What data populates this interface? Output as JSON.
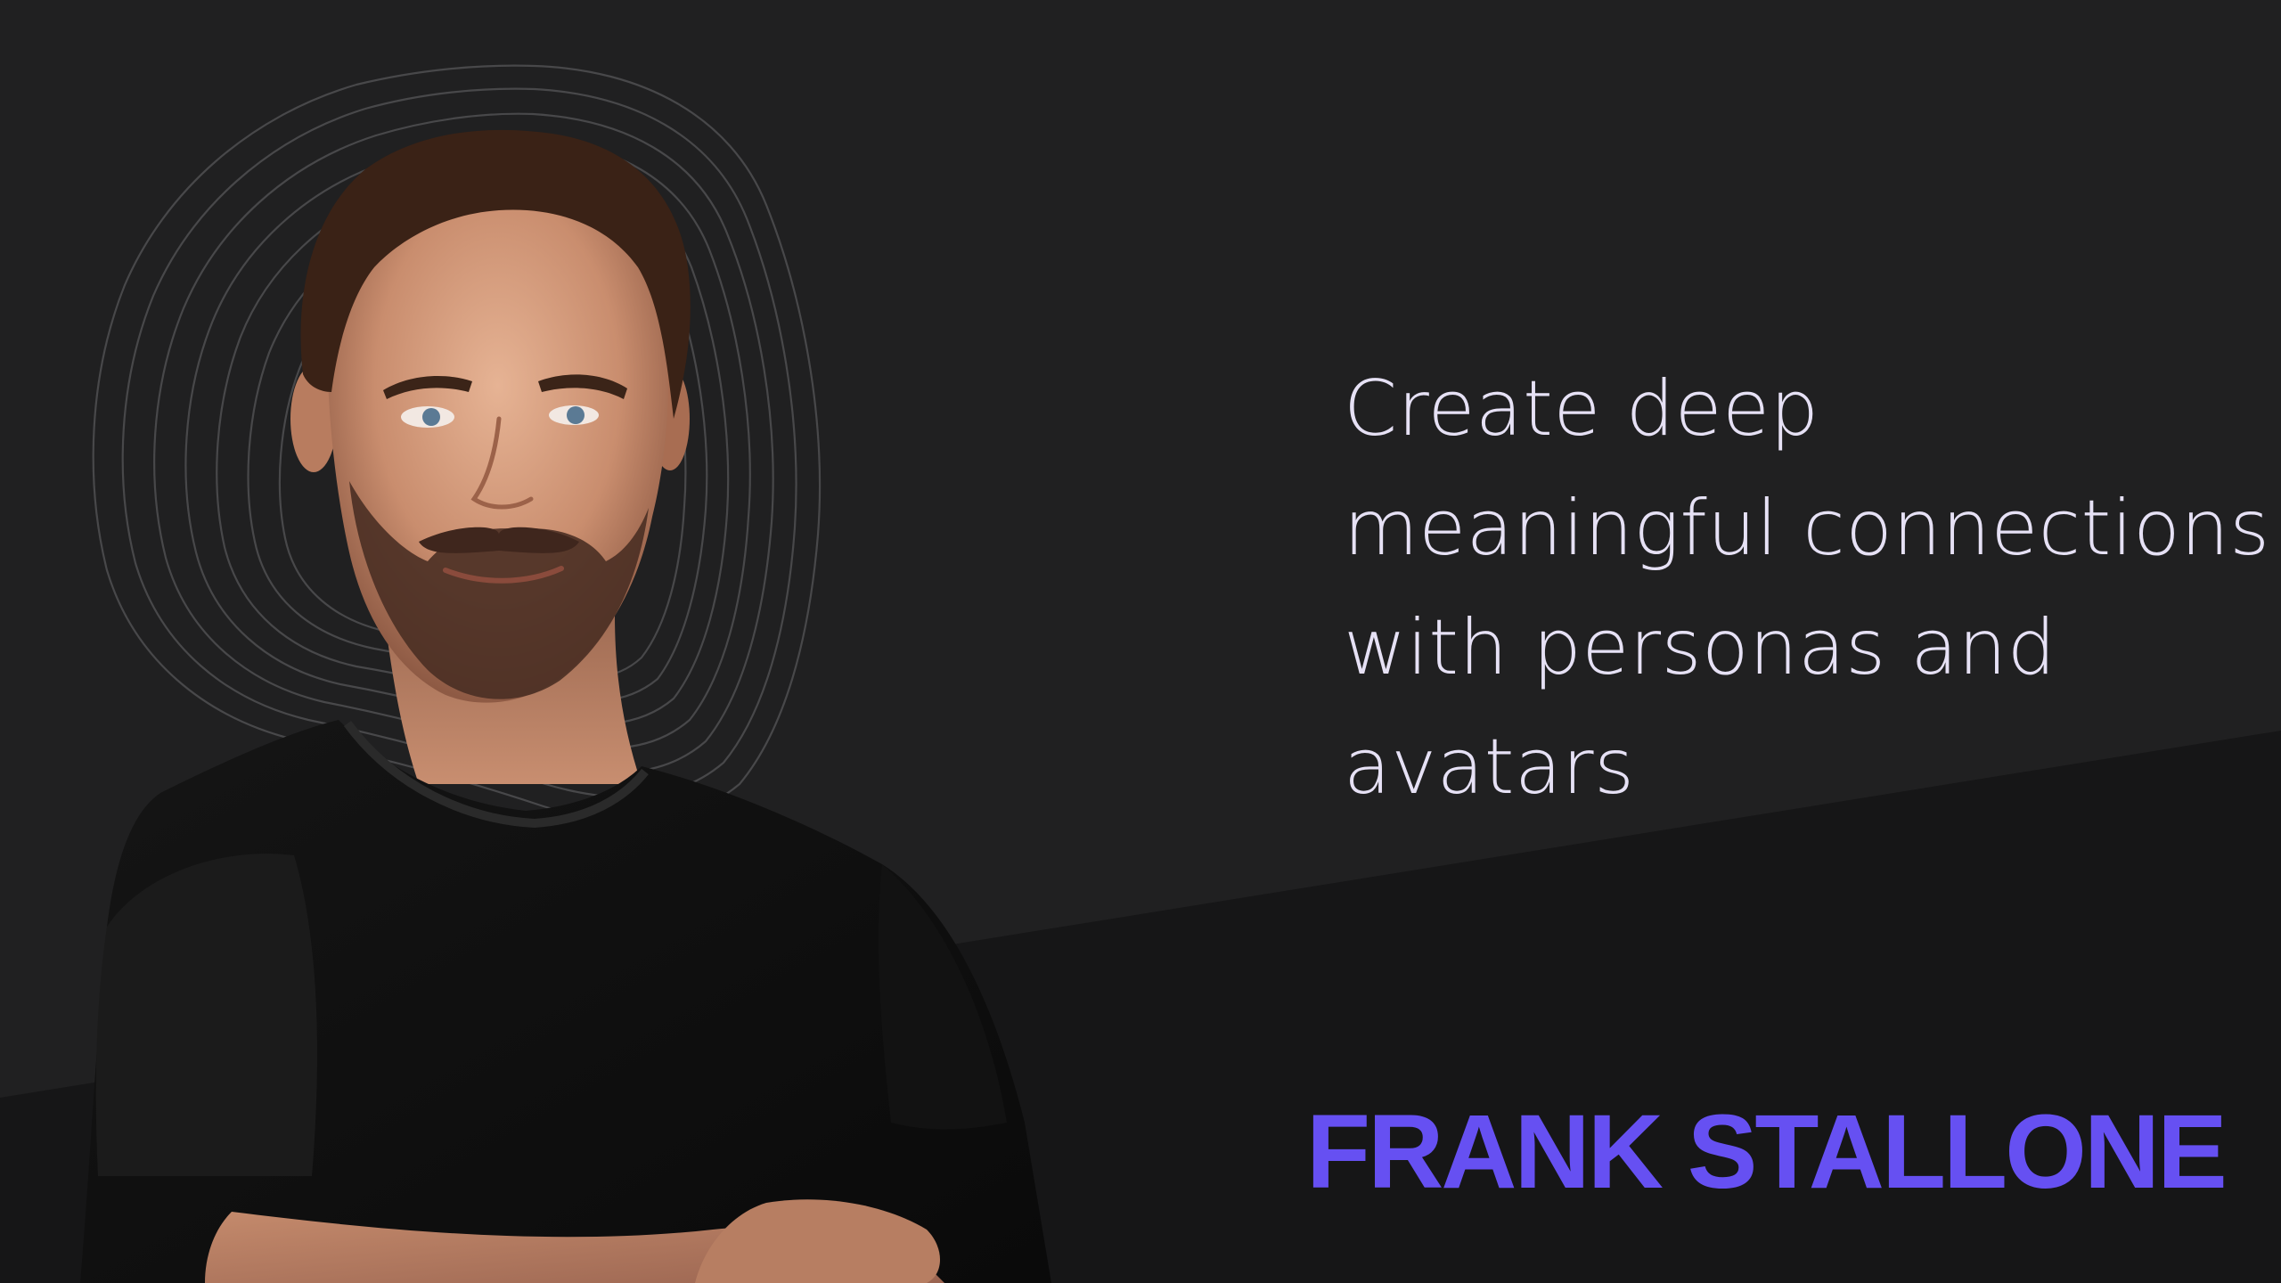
{
  "tagline": {
    "line1": "Create deep",
    "line2": "meaningful connections",
    "line3": "with personas and",
    "line4": "avatars"
  },
  "speaker": {
    "name": "FRANK STALLONE"
  },
  "colors": {
    "background_upper": "#202021",
    "background_lower": "#161617",
    "tagline_text": "#e6e1f5",
    "name_accent": "#6650f2",
    "contour_lines": "#4a4a4c"
  },
  "graphics": {
    "portrait": "speaker-portrait",
    "decoration": "contour-rings"
  }
}
